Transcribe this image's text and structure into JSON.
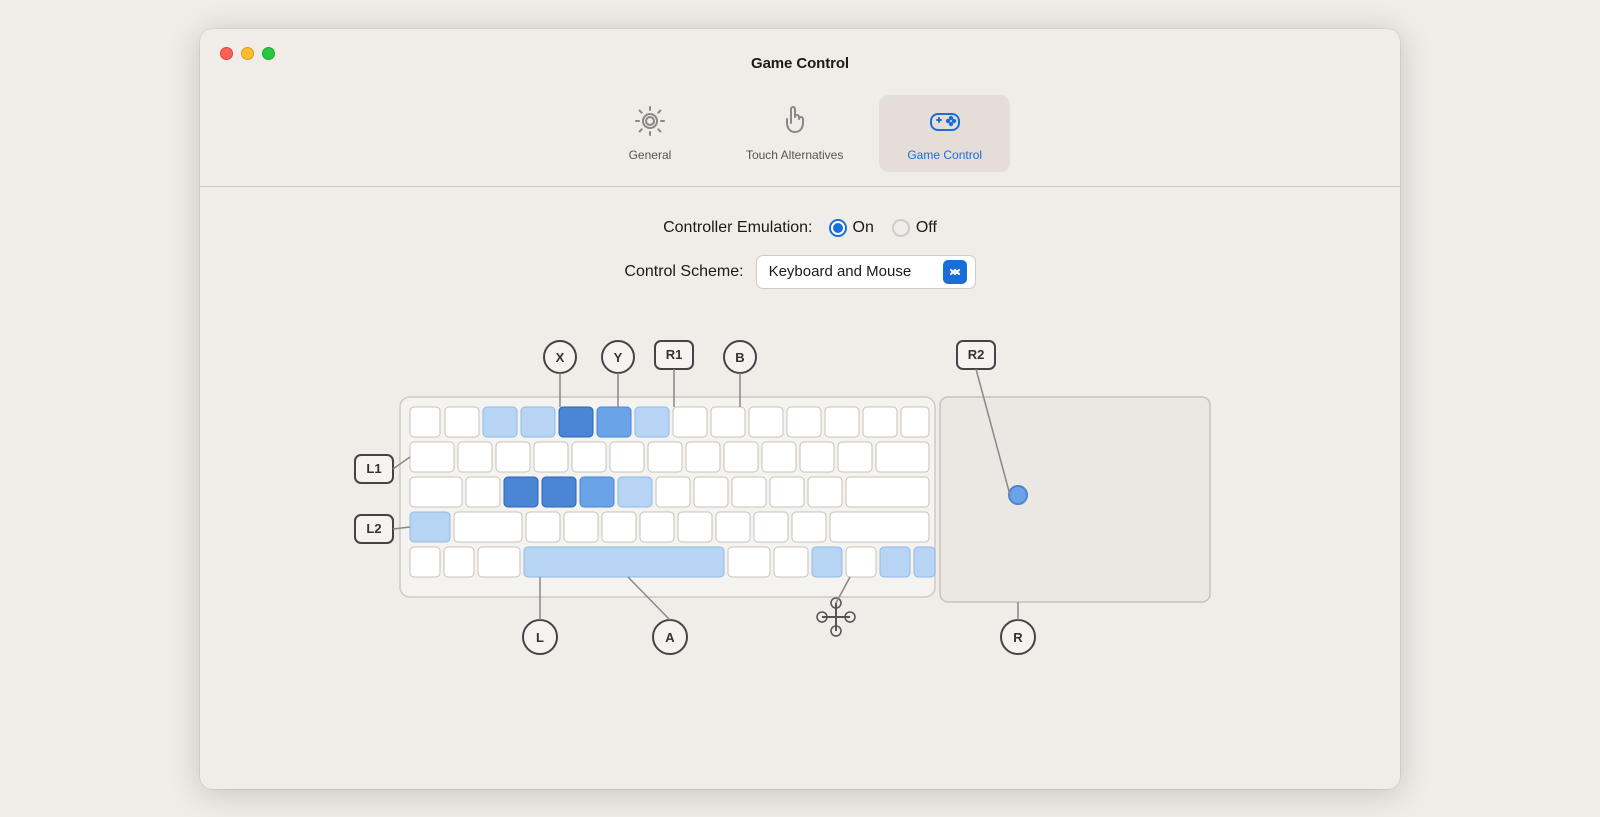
{
  "window": {
    "title": "Game Control"
  },
  "toolbar": {
    "tabs": [
      {
        "id": "general",
        "label": "General",
        "icon": "gear",
        "active": false
      },
      {
        "id": "touch-alternatives",
        "label": "Touch Alternatives",
        "icon": "hand",
        "active": false
      },
      {
        "id": "game-control",
        "label": "Game Control",
        "icon": "gamepad",
        "active": true
      }
    ]
  },
  "settings": {
    "controller_emulation_label": "Controller Emulation:",
    "on_label": "On",
    "off_label": "Off",
    "emulation_on": true,
    "control_scheme_label": "Control Scheme:",
    "control_scheme_value": "Keyboard and Mouse"
  },
  "controller_labels": {
    "X": "X",
    "Y": "Y",
    "R1": "R1",
    "B": "B",
    "R2": "R2",
    "L1": "L1",
    "L2": "L2",
    "L": "L",
    "A": "A",
    "dpad": "✛",
    "R": "R"
  }
}
